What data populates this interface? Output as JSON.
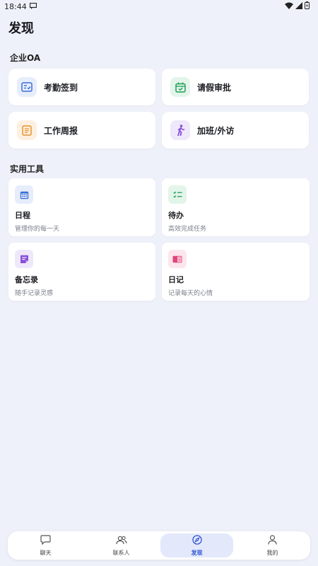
{
  "status_bar": {
    "time": "18:44"
  },
  "page": {
    "title": "发现"
  },
  "sections": {
    "oa": {
      "title": "企业OA"
    },
    "tools": {
      "title": "实用工具"
    }
  },
  "oa_items": [
    {
      "label": "考勤签到",
      "icon": "attendance-card-icon",
      "color": "#3b6fd8",
      "bg": "#e6edfb"
    },
    {
      "label": "请假审批",
      "icon": "calendar-check-icon",
      "color": "#1f9d58",
      "bg": "#e3f5ea"
    },
    {
      "label": "工作周报",
      "icon": "report-document-icon",
      "color": "#e8922c",
      "bg": "#fdf0e0"
    },
    {
      "label": "加班/外访",
      "icon": "walking-person-icon",
      "color": "#8a4fd8",
      "bg": "#efe8fb"
    }
  ],
  "tools": [
    {
      "title": "日程",
      "subtitle": "管理你的每一天",
      "icon": "calendar-icon",
      "color": "#3b6fd8",
      "bg": "#e6edfb"
    },
    {
      "title": "待办",
      "subtitle": "高效完成任务",
      "icon": "checklist-icon",
      "color": "#1f9d58",
      "bg": "#e3f5ea"
    },
    {
      "title": "备忘录",
      "subtitle": "随手记录灵感",
      "icon": "memo-note-icon",
      "color": "#8a4fd8",
      "bg": "#efe8fb"
    },
    {
      "title": "日记",
      "subtitle": "记录每天的心情",
      "icon": "diary-book-icon",
      "color": "#e0457b",
      "bg": "#fce6ee"
    }
  ],
  "bottom_nav": {
    "items": [
      {
        "label": "聊天",
        "icon": "chat-bubble-icon"
      },
      {
        "label": "联系人",
        "icon": "contacts-icon"
      },
      {
        "label": "发现",
        "icon": "compass-icon",
        "active": true
      },
      {
        "label": "我的",
        "icon": "profile-icon"
      }
    ],
    "active_color": "#2f55d4"
  }
}
